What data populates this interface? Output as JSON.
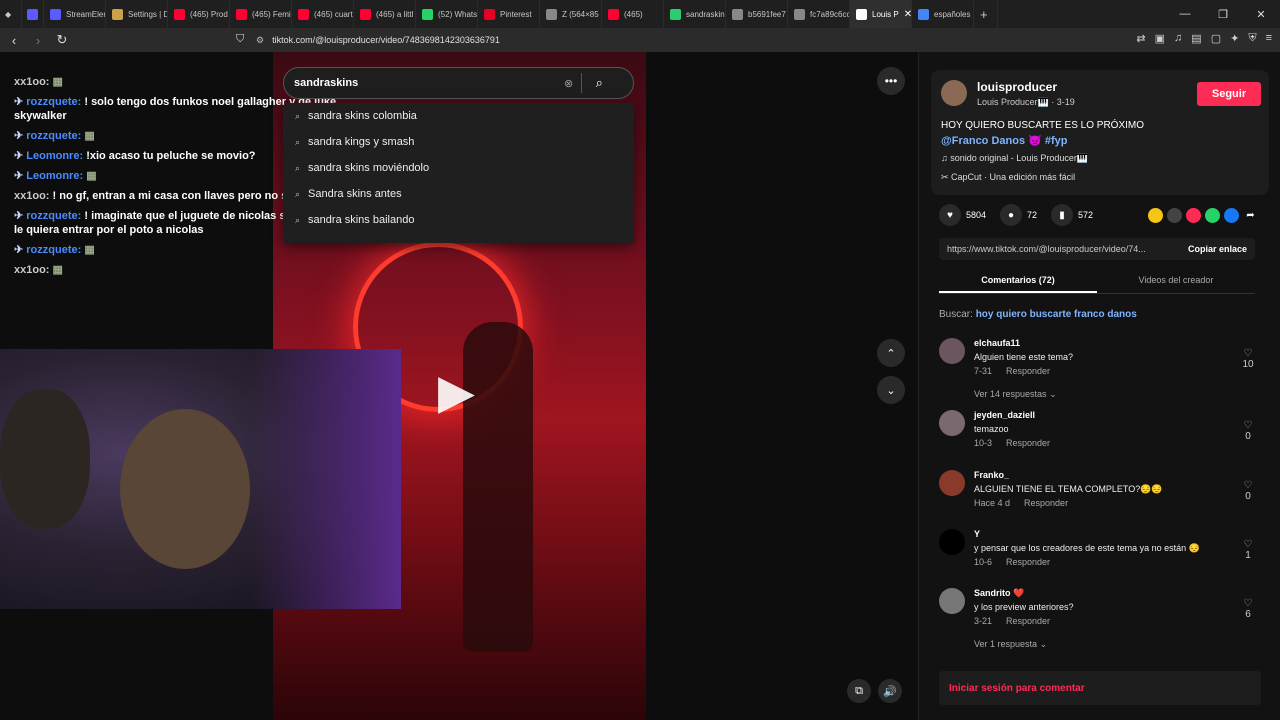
{
  "browser": {
    "tabs": [
      {
        "title": "StreamElem",
        "color": "#5b5bff"
      },
      {
        "title": "Settings | D",
        "color": "#caa24a"
      },
      {
        "title": "(465) Prod",
        "color": "#ff0033"
      },
      {
        "title": "(465) Femi",
        "color": "#ff0033"
      },
      {
        "title": "(465) cuart",
        "color": "#ff0033"
      },
      {
        "title": "(465) a littl",
        "color": "#ff0033"
      },
      {
        "title": "(52) Whats",
        "color": "#25d366"
      },
      {
        "title": "Pinterest",
        "color": "#e60023"
      },
      {
        "title": "Z (564×85",
        "color": "#888888"
      },
      {
        "title": "(465)",
        "color": "#ff0033"
      },
      {
        "title": "sandraskins",
        "color": "#2ecc71"
      },
      {
        "title": "b5691fee7",
        "color": "#888888"
      },
      {
        "title": "fc7a89c6cc",
        "color": "#888888"
      },
      {
        "title": "Louis P",
        "color": "#ffffff",
        "active": true
      },
      {
        "title": "españoles",
        "color": "#4285f4"
      }
    ],
    "url": "tiktok.com/@louisproducer/video/7483698142303636791"
  },
  "chat": [
    {
      "user": "xx1oo:",
      "msg": "",
      "style": "grey"
    },
    {
      "user": "rozzquete:",
      "msg": "! solo tengo dos funkos noel gallagher y de luke skywalker",
      "style": "blue"
    },
    {
      "user": "rozzquete:",
      "msg": "",
      "style": "blue"
    },
    {
      "user": "Leomonre:",
      "msg": "!xio acaso tu peluche se movio?",
      "style": "blue"
    },
    {
      "user": "Leomonre:",
      "msg": "",
      "style": "blue"
    },
    {
      "user": "xx1oo:",
      "msg": "! no gf, entran a mi casa con llaves pero no se ve a nadie",
      "style": "grey"
    },
    {
      "user": "rozzquete:",
      "msg": "! imaginate que el juguete de nicolas se mueva y se le quiera entrar por el poto a nicolas",
      "style": "blue"
    },
    {
      "user": "rozzquete:",
      "msg": "",
      "style": "blue"
    },
    {
      "user": "xx1oo:",
      "msg": "",
      "style": "grey"
    }
  ],
  "search": {
    "query": "sandraskins",
    "suggestions": [
      "sandra skins colombia",
      "sandra kings y smash",
      "sandra skins moviéndolo",
      "Sandra skins antes",
      "sandra skins bailando"
    ]
  },
  "post": {
    "username": "louisproducer",
    "subname": "Louis Producer🎹 · 3-19",
    "follow": "Seguir",
    "description": "HOY QUIERO BUSCARTE ES LO PRÓXIMO",
    "tags": "@Franco Danos 👿 #fyp",
    "sound": "sonido original - Louis Producer🎹",
    "capcut": "CapCut · Una edición más fácil",
    "likes": "5804",
    "comments": "72",
    "saves": "572",
    "link": "https://www.tiktok.com/@louisproducer/video/74...",
    "copy": "Copiar enlace",
    "tab_comments": "Comentarios (72)",
    "tab_videos": "Videos del creador",
    "search_label": "Buscar:",
    "search_query": "hoy quiero buscarte franco danos"
  },
  "comments": [
    {
      "user": "elchaufa11",
      "text": "Alguien tiene este tema?",
      "date": "7-31",
      "reply": "Responder",
      "likes": "10",
      "replies": "Ver 14 respuestas"
    },
    {
      "user": "jeyden_daziell",
      "text": "temazoo",
      "date": "10-3",
      "reply": "Responder",
      "likes": "0",
      "replies": ""
    },
    {
      "user": "Franko_",
      "text": "ALGUIEN TIENE EL TEMA COMPLETO?😔😔",
      "date": "Hace 4 d",
      "reply": "Responder",
      "likes": "0",
      "replies": ""
    },
    {
      "user": "Y",
      "text": "y pensar que los creadores de este tema ya no están 😔",
      "date": "10-6",
      "reply": "Responder",
      "likes": "1",
      "replies": ""
    },
    {
      "user": "Sandrito ❤️",
      "text": "y los preview anteriores?",
      "date": "3-21",
      "reply": "Responder",
      "likes": "6",
      "replies": "Ver 1 respuesta"
    }
  ],
  "login": "Iniciar sesión para comentar"
}
